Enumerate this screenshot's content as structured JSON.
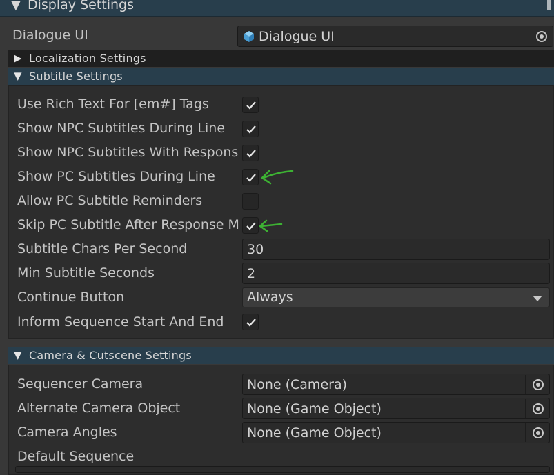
{
  "display_settings": {
    "title": "Display Settings"
  },
  "dialogue_ui": {
    "label": "Dialogue UI",
    "value": "Dialogue UI",
    "icon": "cube-icon"
  },
  "localization": {
    "title": "Localization Settings"
  },
  "subtitle": {
    "title": "Subtitle Settings",
    "use_rich_text": {
      "label": "Use Rich Text For [em#] Tags",
      "checked": true
    },
    "show_npc_during_line": {
      "label": "Show NPC Subtitles During Line",
      "checked": true
    },
    "show_npc_with_responses": {
      "label": "Show NPC Subtitles With Responses",
      "checked": true
    },
    "show_pc_during_line": {
      "label": "Show PC Subtitles During Line",
      "checked": true
    },
    "allow_pc_reminders": {
      "label": "Allow PC Subtitle Reminders",
      "checked": false
    },
    "skip_pc_after_response_menu": {
      "label": "Skip PC Subtitle After Response Menu",
      "checked": true
    },
    "chars_per_second": {
      "label": "Subtitle Chars Per Second",
      "value": "30"
    },
    "min_seconds": {
      "label": "Min Subtitle Seconds",
      "value": "2"
    },
    "continue_button": {
      "label": "Continue Button",
      "value": "Always"
    },
    "inform_sequence": {
      "label": "Inform Sequence Start And End",
      "checked": true
    }
  },
  "camera": {
    "title": "Camera & Cutscene Settings",
    "sequencer_camera": {
      "label": "Sequencer Camera",
      "value": "None (Camera)"
    },
    "alternate_camera_object": {
      "label": "Alternate Camera Object",
      "value": "None (Game Object)"
    },
    "camera_angles": {
      "label": "Camera Angles",
      "value": "None (Game Object)"
    },
    "default_sequence": {
      "label": "Default Sequence"
    }
  },
  "colors": {
    "header_blue": "#283e4c",
    "annotation_arrow": "#3db233"
  }
}
